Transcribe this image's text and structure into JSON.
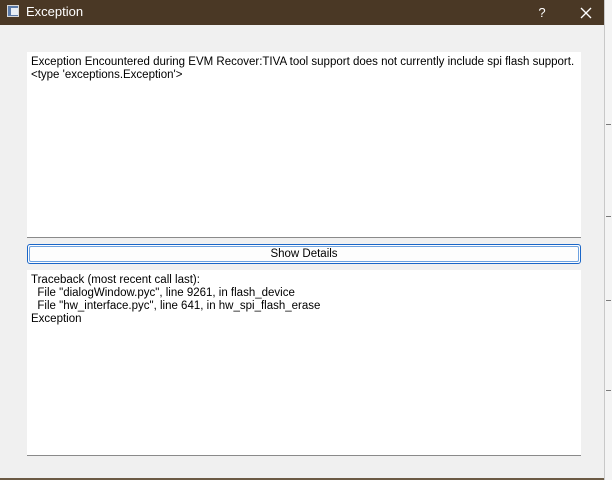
{
  "window": {
    "title": "Exception",
    "help_label": "?",
    "close_icon": "close-icon",
    "titlebar_color": "#4a3825"
  },
  "summary": {
    "text": "Exception Encountered during EVM Recover:TIVA tool support does not currently include spi flash support.\n<type 'exceptions.Exception'>"
  },
  "details_button": {
    "label": "Show Details",
    "border_color": "#1a66c8"
  },
  "details": {
    "text": "Traceback (most recent call last):\n  File \"dialogWindow.pyc\", line 9261, in flash_device\n  File \"hw_interface.pyc\", line 641, in hw_spi_flash_erase\nException"
  }
}
